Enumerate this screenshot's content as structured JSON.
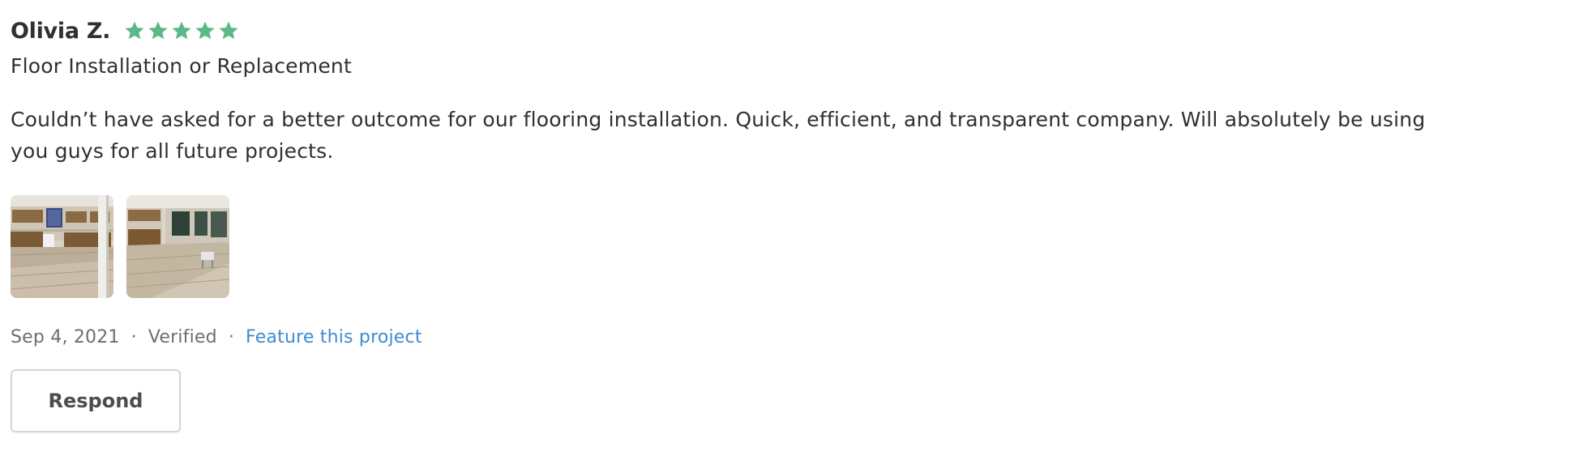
{
  "review": {
    "reviewer_name": "Olivia Z.",
    "rating": 5,
    "rating_max": 5,
    "star_color": "#5cb887",
    "service": "Floor Installation or Replacement",
    "text": "Couldn’t have asked for a better outcome for our flooring installation. Quick, efficient, and transparent company. Will absolutely be using you guys for all future projects.",
    "photos": [
      {
        "icon": "project-photo-kitchen"
      },
      {
        "icon": "project-photo-living-room"
      }
    ],
    "date": "Sep 4, 2021",
    "separator": "·",
    "status": "Verified",
    "feature_link_label": "Feature this project",
    "link_color": "#3d8bd0",
    "respond_label": "Respond"
  }
}
